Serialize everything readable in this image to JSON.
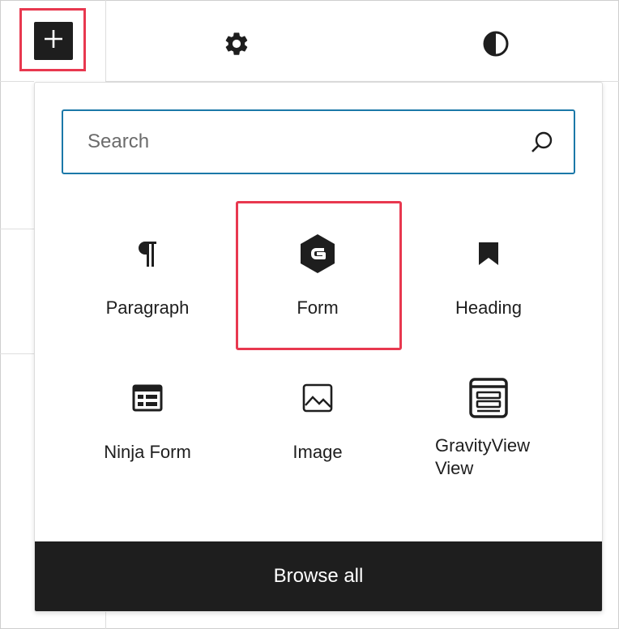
{
  "toolbar": {
    "inserter_icon": "plus-icon",
    "settings_icon": "gear-icon",
    "styles_icon": "contrast-icon"
  },
  "inserter": {
    "search": {
      "placeholder": "Search",
      "value": ""
    },
    "blocks": [
      {
        "label": "Paragraph",
        "icon": "paragraph-icon"
      },
      {
        "label": "Form",
        "icon": "gravity-forms-icon"
      },
      {
        "label": "Heading",
        "icon": "bookmark-icon"
      },
      {
        "label": "Ninja Form",
        "icon": "form-table-icon"
      },
      {
        "label": "Image",
        "icon": "image-icon"
      },
      {
        "label": "GravityView View",
        "label_line1": "GravityView",
        "label_line2": "View",
        "icon": "gravityview-icon"
      }
    ],
    "browse_all": "Browse all"
  },
  "colors": {
    "accent": "#1b78a8",
    "highlight": "#e8384f",
    "dark": "#1e1e1e"
  }
}
